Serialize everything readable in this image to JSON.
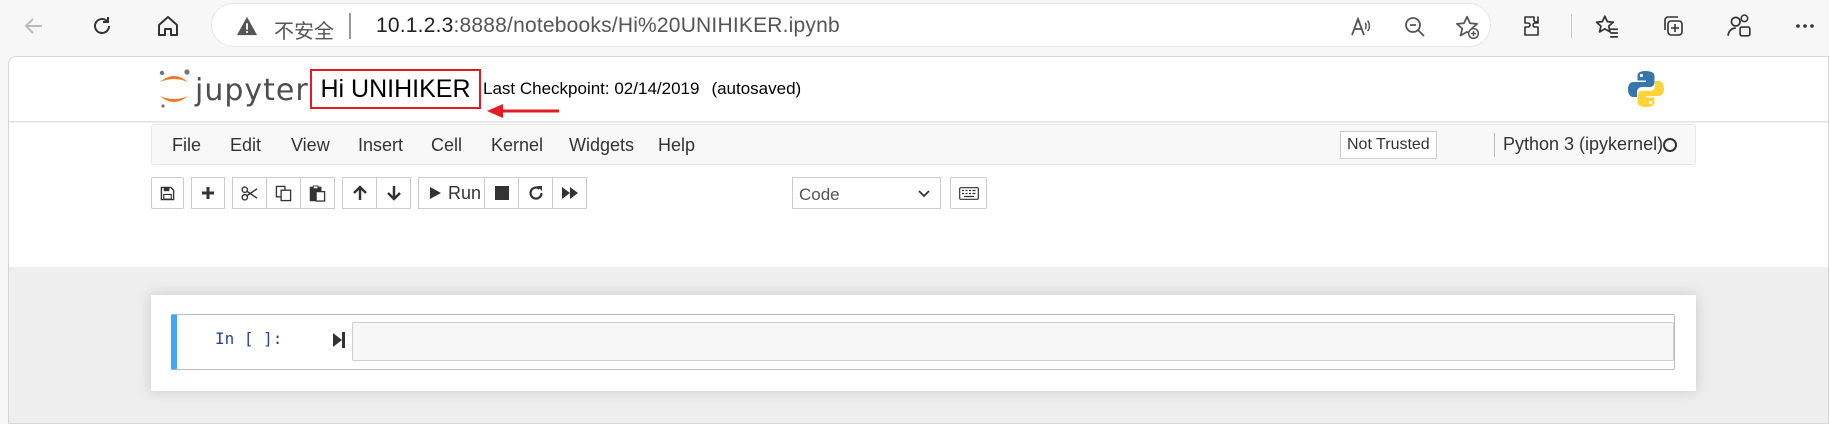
{
  "browser": {
    "insecure_label": "不安全",
    "url_host": "10.1.2.3",
    "url_rest": ":8888/notebooks/Hi%20UNIHIKER.ipynb"
  },
  "header": {
    "logo_text": "jupyter",
    "notebook_title": "Hi UNIHIKER",
    "checkpoint": "Last Checkpoint: 02/14/2019",
    "autosave": "(autosaved)",
    "annotation_color": "#e31b23"
  },
  "menubar": {
    "items": [
      "File",
      "Edit",
      "View",
      "Insert",
      "Cell",
      "Kernel",
      "Widgets",
      "Help"
    ],
    "trust_label": "Not Trusted",
    "kernel_label": "Python 3 (ipykernel)"
  },
  "toolbar": {
    "run_label": "Run",
    "cell_type": "Code"
  },
  "cell": {
    "prompt": "In [ ]:",
    "accent_color": "#42a5f5"
  }
}
